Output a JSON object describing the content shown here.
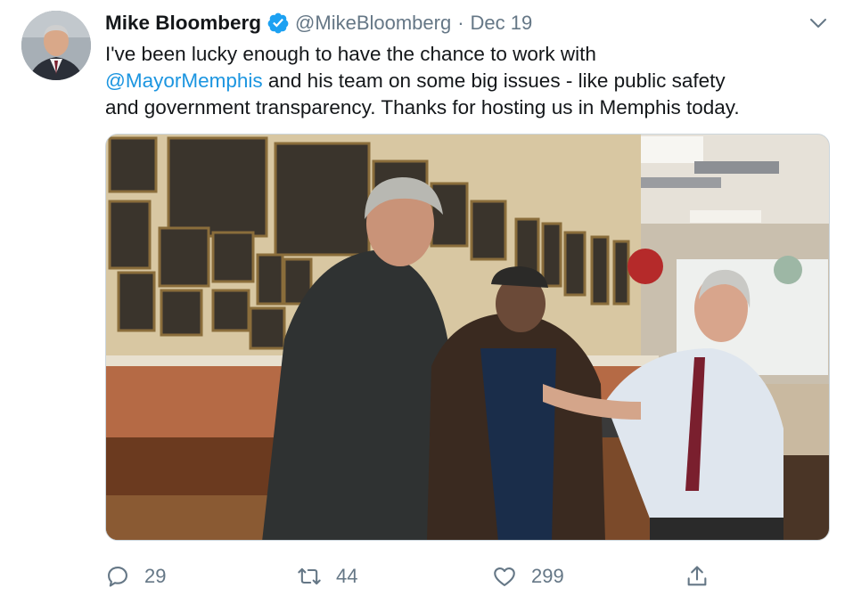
{
  "tweet": {
    "author_name": "Mike Bloomberg",
    "handle": "@MikeBloomberg",
    "separator": "·",
    "date": "Dec 19",
    "text_line1": "I've been lucky enough to have the chance to work with",
    "mention": "@MayorMemphis",
    "text_line2_rest": " and his team on some big issues - like public safety",
    "text_line3": "and government transparency. Thanks for hosting us in Memphis today."
  },
  "actions": {
    "reply_count": "29",
    "retweet_count": "44",
    "like_count": "299"
  },
  "icons": {
    "verified": "verified-badge-icon",
    "menu": "chevron-down-icon",
    "reply": "reply-icon",
    "retweet": "retweet-icon",
    "like": "heart-icon",
    "share": "share-icon"
  },
  "colors": {
    "text": "#14171a",
    "secondary": "#657786",
    "link": "#1b95e0",
    "verified": "#1da1f2"
  }
}
